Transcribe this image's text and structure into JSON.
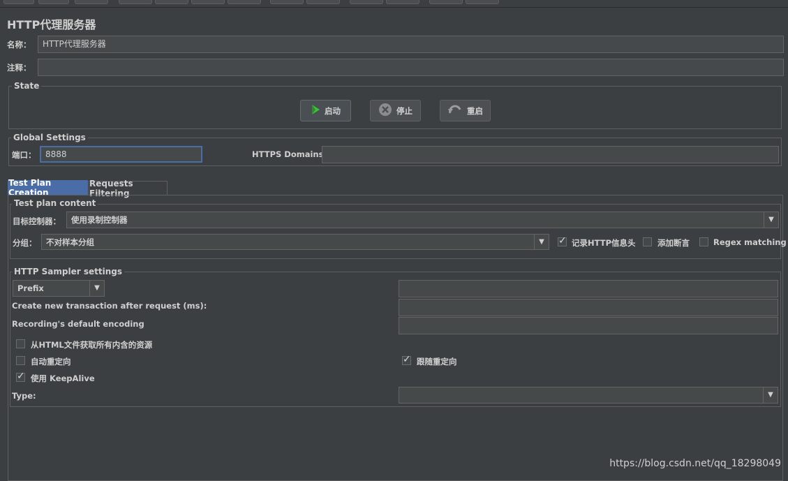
{
  "panel_title": "HTTP代理服务器",
  "name_label": "名称：",
  "name_value": "HTTP代理服务器",
  "comment_label": "注释：",
  "comment_value": "",
  "state": {
    "legend": "State",
    "start_label": "启动",
    "stop_label": "停止",
    "restart_label": "重启"
  },
  "global": {
    "legend": "Global Settings",
    "port_label": "端口：",
    "port_value": "8888",
    "https_label": "HTTPS Domains:",
    "https_value": ""
  },
  "tabs": [
    "Test Plan Creation",
    "Requests Filtering"
  ],
  "test_plan": {
    "legend": "Test plan content",
    "target_label": "目标控制器：",
    "target_value": "使用录制控制器",
    "group_label": "分组：",
    "group_value": "不对样本分组",
    "checkbox_record_headers": {
      "label": "记录HTTP信息头",
      "checked": true
    },
    "checkbox_add_assertions": {
      "label": "添加断言",
      "checked": false
    },
    "checkbox_regex": {
      "label": "Regex matching",
      "checked": false
    }
  },
  "sampler": {
    "legend": "HTTP Sampler settings",
    "prefix_value": "Prefix",
    "prefix_field_value": "",
    "transaction_label": "Create new transaction after request (ms):",
    "transaction_value": "",
    "encoding_label": "Recording's default encoding",
    "encoding_value": "",
    "checkbox_fetch_resources": {
      "label": "从HTML文件获取所有内含的资源",
      "checked": false
    },
    "checkbox_auto_redirect": {
      "label": "自动重定向",
      "checked": false
    },
    "checkbox_follow_redirect": {
      "label": "跟随重定向",
      "checked": true
    },
    "checkbox_keepalive": {
      "label": "使用 KeepAlive",
      "checked": true
    },
    "type_label": "Type:",
    "type_value": ""
  },
  "watermark": "https://blog.csdn.net/qq_18298049",
  "colors": {
    "background": "#3c3f41",
    "accent": "#4a6da7",
    "start_icon": "#3fbf3f"
  }
}
